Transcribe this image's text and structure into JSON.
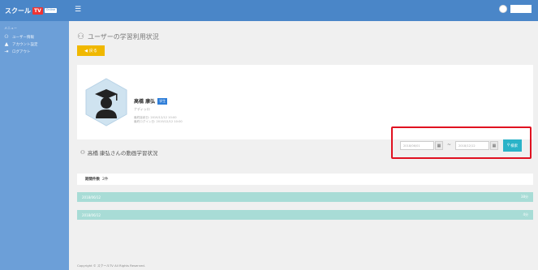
{
  "header": {
    "logo_text": "スクール",
    "logo_tv": "TV",
    "logo_sub": "Online",
    "menu_icon": "hamburger-icon"
  },
  "sidebar": {
    "heading": "メニュー",
    "items": [
      {
        "label": "ユーザー情報",
        "icon": "user-icon"
      },
      {
        "label": "アカウント設定",
        "icon": "settings-icon"
      },
      {
        "label": "ログアウト",
        "icon": "logout-icon"
      }
    ]
  },
  "page": {
    "title": "ユーザーの学習利用状況",
    "back_label": "戻る"
  },
  "profile": {
    "name": "高橋 康弘",
    "badge": "学生",
    "sub": "ナディッロ",
    "meta_line1": "最終接続日: 2019/12/12 10:00",
    "meta_line2": "最終ログイン日: 2019/12/12 10:00"
  },
  "section": {
    "title": "高橋 康弘さんの動画学習状況"
  },
  "filter": {
    "from_date": "2018/06/01",
    "to_date": "2018/12/12",
    "separator": "~",
    "search_label": "検索"
  },
  "list": {
    "count_label": "期間件数",
    "count_value": "2件",
    "rows": [
      {
        "date": "2018/06/12",
        "value": "38分"
      },
      {
        "date": "2018/06/12",
        "value": "4分"
      }
    ]
  },
  "footer": {
    "text": "Copyright © スクールTV All Rights Reserved."
  },
  "colors": {
    "topbar": "#4a86c8",
    "sidebar": "#6c9fd8",
    "back_button": "#f0b800",
    "search_button": "#2bb3c8",
    "row": "#a8dcd6",
    "highlight": "#e01020"
  }
}
